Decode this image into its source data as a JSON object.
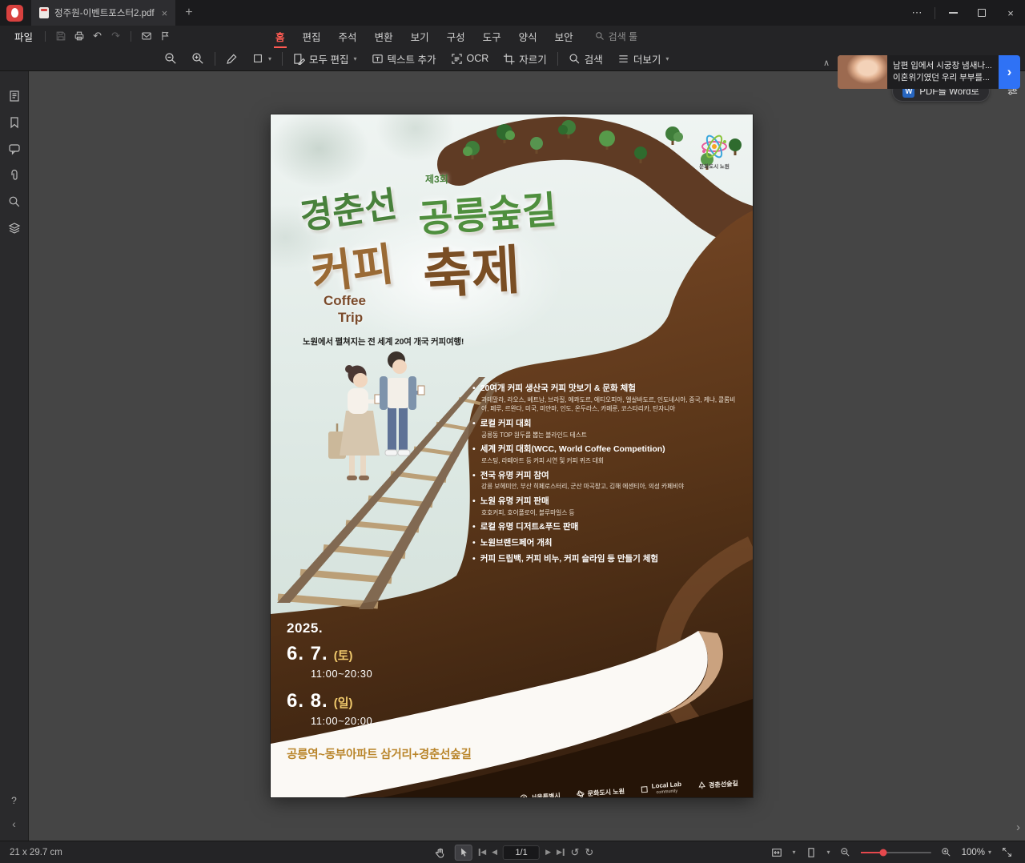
{
  "glyphs": {
    "more": "⋯",
    "close": "×",
    "plus": "+",
    "caret": "▾",
    "undo": "↶",
    "redo": "↷",
    "collapse": "∧",
    "chevron_left": "‹",
    "chevron_right": "›",
    "help": "?",
    "rotate_left": "↺",
    "rotate_right": "↻",
    "prev": "◀",
    "next": "▶",
    "w": "W"
  },
  "titlebar": {
    "tab_title": "정주원-이벤트포스터2.pdf"
  },
  "menubar": {
    "file": "파일",
    "tabs": [
      "홈",
      "편집",
      "주석",
      "변환",
      "보기",
      "구성",
      "도구",
      "양식",
      "보안"
    ],
    "search_tool": "검색 툴"
  },
  "ad": {
    "line1": "남편 입에서 시궁창 냄새나...",
    "line2": "이혼위기였던 우리 부부를..."
  },
  "toolbar": {
    "edit_all": "모두 편집",
    "add_text": "텍스트 추가",
    "ocr": "OCR",
    "crop": "자르기",
    "search": "검색",
    "more": "더보기"
  },
  "canvas": {
    "pdf_to_word": "PDF를 Word로"
  },
  "statusbar": {
    "doc_size": "21 x 29.7 cm",
    "page": "1/1",
    "zoom": "100%"
  },
  "poster": {
    "badge": "제3회",
    "title_line1": [
      "경춘선",
      "공릉숲길"
    ],
    "title_line2": [
      "커피",
      "축제"
    ],
    "coffee_trip": [
      "Coffee",
      "Trip"
    ],
    "subtitle": "노원에서 펼쳐지는 전 세계 20여 개국 커피여행!",
    "logo_text": "문화도시 노원",
    "bullets": [
      {
        "title": "20여개 커피 생산국 커피 맛보기 & 문화 체험",
        "desc": "과테말라, 라오스, 베트남, 브라질, 에콰도르, 에티오피아, 엘살바도르, 인도네시아, 중국, 케냐, 콜롬비아, 페루, 르완다, 미국, 미얀마, 인도, 온두라스, 카메룬, 코스타리카, 탄자니아"
      },
      {
        "title": "로컬 커피 대회",
        "desc": "공릉동 TOP 원두를 뽑는 블라인드 테스트"
      },
      {
        "title": "세계 커피 대회(WCC, World Coffee Competition)",
        "desc": "로스팅, 라떼아트 등 커피 시연 및 커피 퀴즈 대회"
      },
      {
        "title": "전국 유명 커피 참여",
        "desc": "강릉 보헤미안, 부산 히페로스터리, 군산 마곡창고, 김해 에센티아, 의성 카페비야"
      },
      {
        "title": "노원 유명 커피 판매",
        "desc": "호호커피, 호이폴로이, 블루마일스 등"
      },
      {
        "title": "로컬 유명 디저트&푸드 판매",
        "desc": ""
      },
      {
        "title": "노원브랜드페어 개최",
        "desc": ""
      },
      {
        "title": "커피 드립백, 커피 비누, 커피 슬라임 등 만들기 체험",
        "desc": ""
      }
    ],
    "schedule": {
      "year": "2025.",
      "days": [
        {
          "date": "6. 7.",
          "dow": "(토)",
          "time": "11:00~20:30"
        },
        {
          "date": "6. 8.",
          "dow": "(일)",
          "time": "11:00~20:00"
        }
      ]
    },
    "location": "공릉역~동부아파트 삼거리+경춘선숲길",
    "footer": {
      "seoul": "서울특별시",
      "nowon": "문화도시 노원",
      "lab": "Local Lab",
      "lab_sub": "community",
      "trail": "경춘선숲길"
    }
  }
}
